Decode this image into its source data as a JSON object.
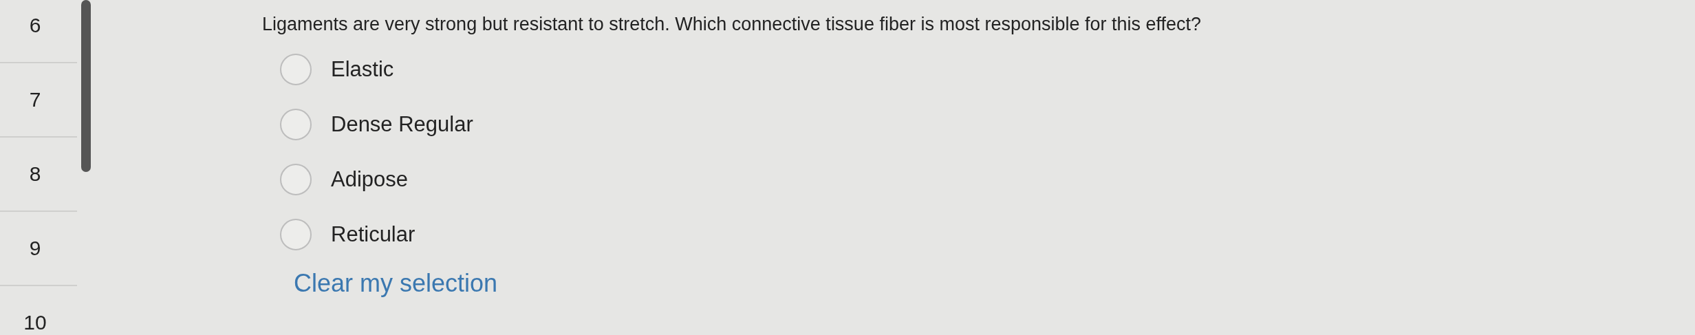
{
  "sidebar": {
    "items": [
      {
        "label": "6"
      },
      {
        "label": "7"
      },
      {
        "label": "8"
      },
      {
        "label": "9"
      },
      {
        "label": "10"
      }
    ]
  },
  "question": {
    "prompt": "Ligaments are very strong but resistant to stretch. Which connective tissue fiber is most responsible for this effect?",
    "options": [
      {
        "label": "Elastic",
        "selected": false
      },
      {
        "label": "Dense Regular",
        "selected": false
      },
      {
        "label": "Adipose",
        "selected": false
      },
      {
        "label": "Reticular",
        "selected": false
      }
    ],
    "clear_link": "Clear my selection"
  }
}
